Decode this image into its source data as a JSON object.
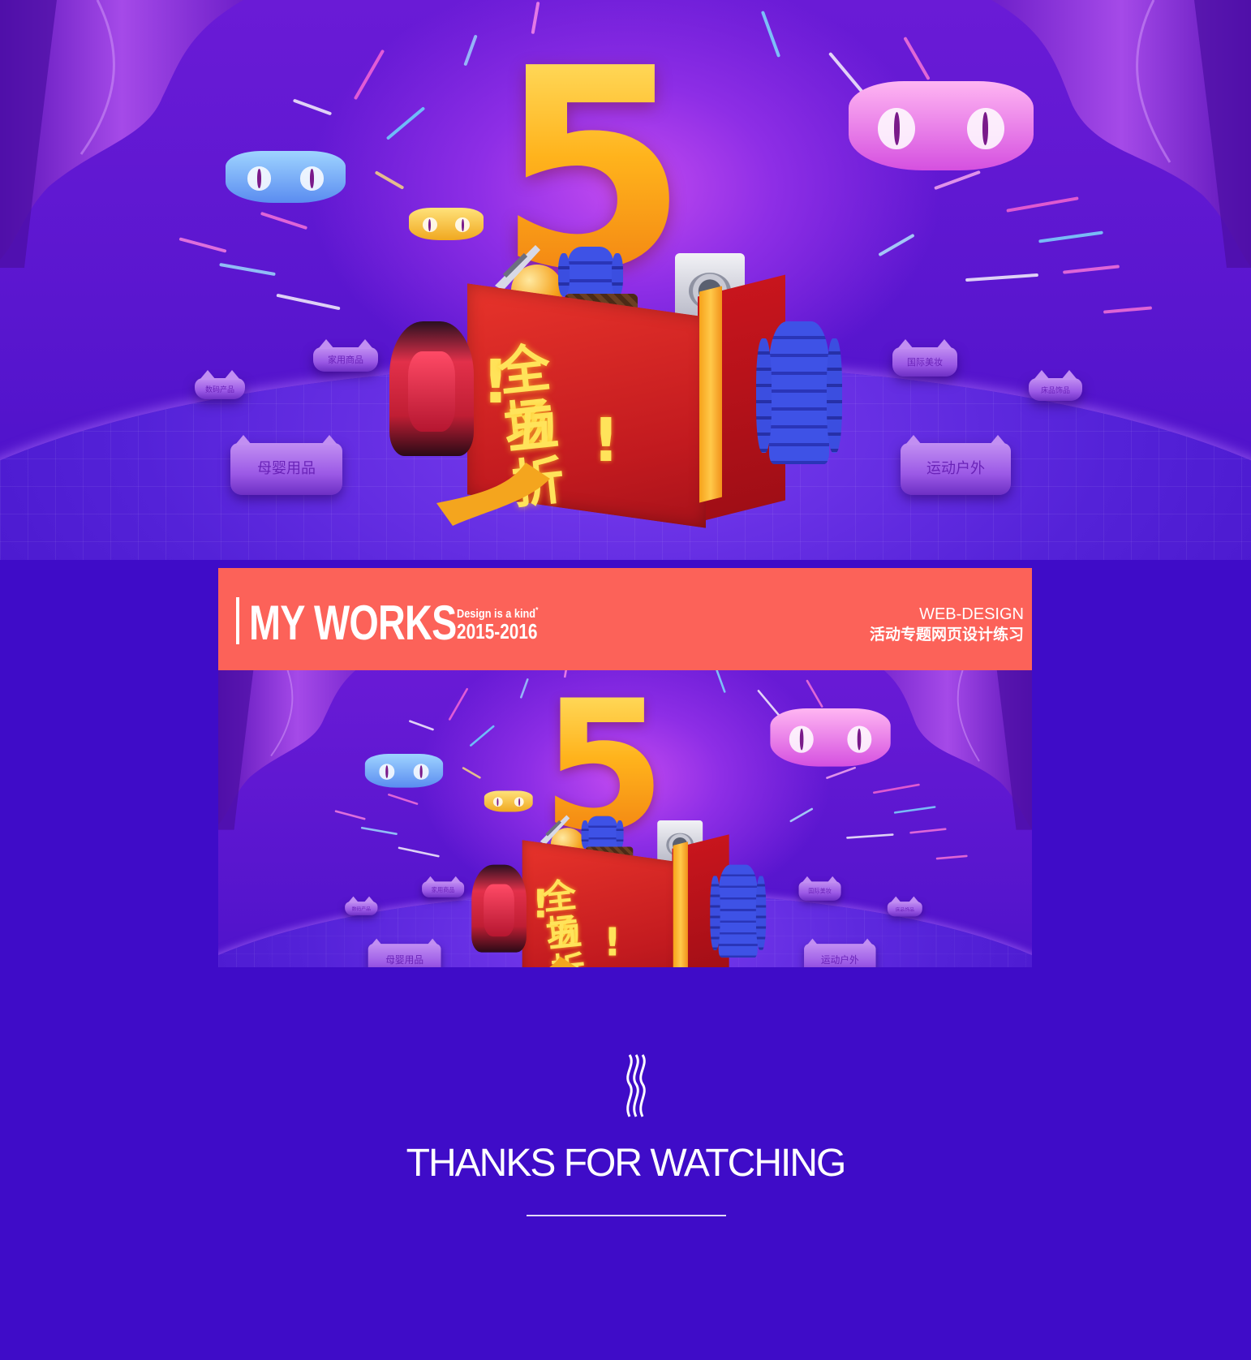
{
  "hero": {
    "big_number": "5",
    "gift_line1": "全场",
    "gift_line2": "五折",
    "exclaim": "!",
    "pedestals": [
      {
        "label": "家用商品"
      },
      {
        "label": "数码产品"
      },
      {
        "label": "母婴用品"
      },
      {
        "label": "国际美妆"
      },
      {
        "label": "床品饰品"
      },
      {
        "label": "运动户外"
      }
    ],
    "colors": {
      "background": "#4a12c9",
      "glow": "#c34bf0",
      "balloon_gold": "#ffb21c",
      "gift_red": "#c21a1f",
      "pedestal": "#9b59e6"
    }
  },
  "works": {
    "title": "MY WORKS",
    "tagline": "Design is a kind",
    "tagline_mark": "*",
    "years": "2015-2016",
    "category": "WEB-DESIGN",
    "subtitle": "活动专题网页设计练习",
    "accent": "#fc6259"
  },
  "footer": {
    "icon": "wave-lines-icon",
    "thanks": "THANKS FOR WATCHING"
  }
}
